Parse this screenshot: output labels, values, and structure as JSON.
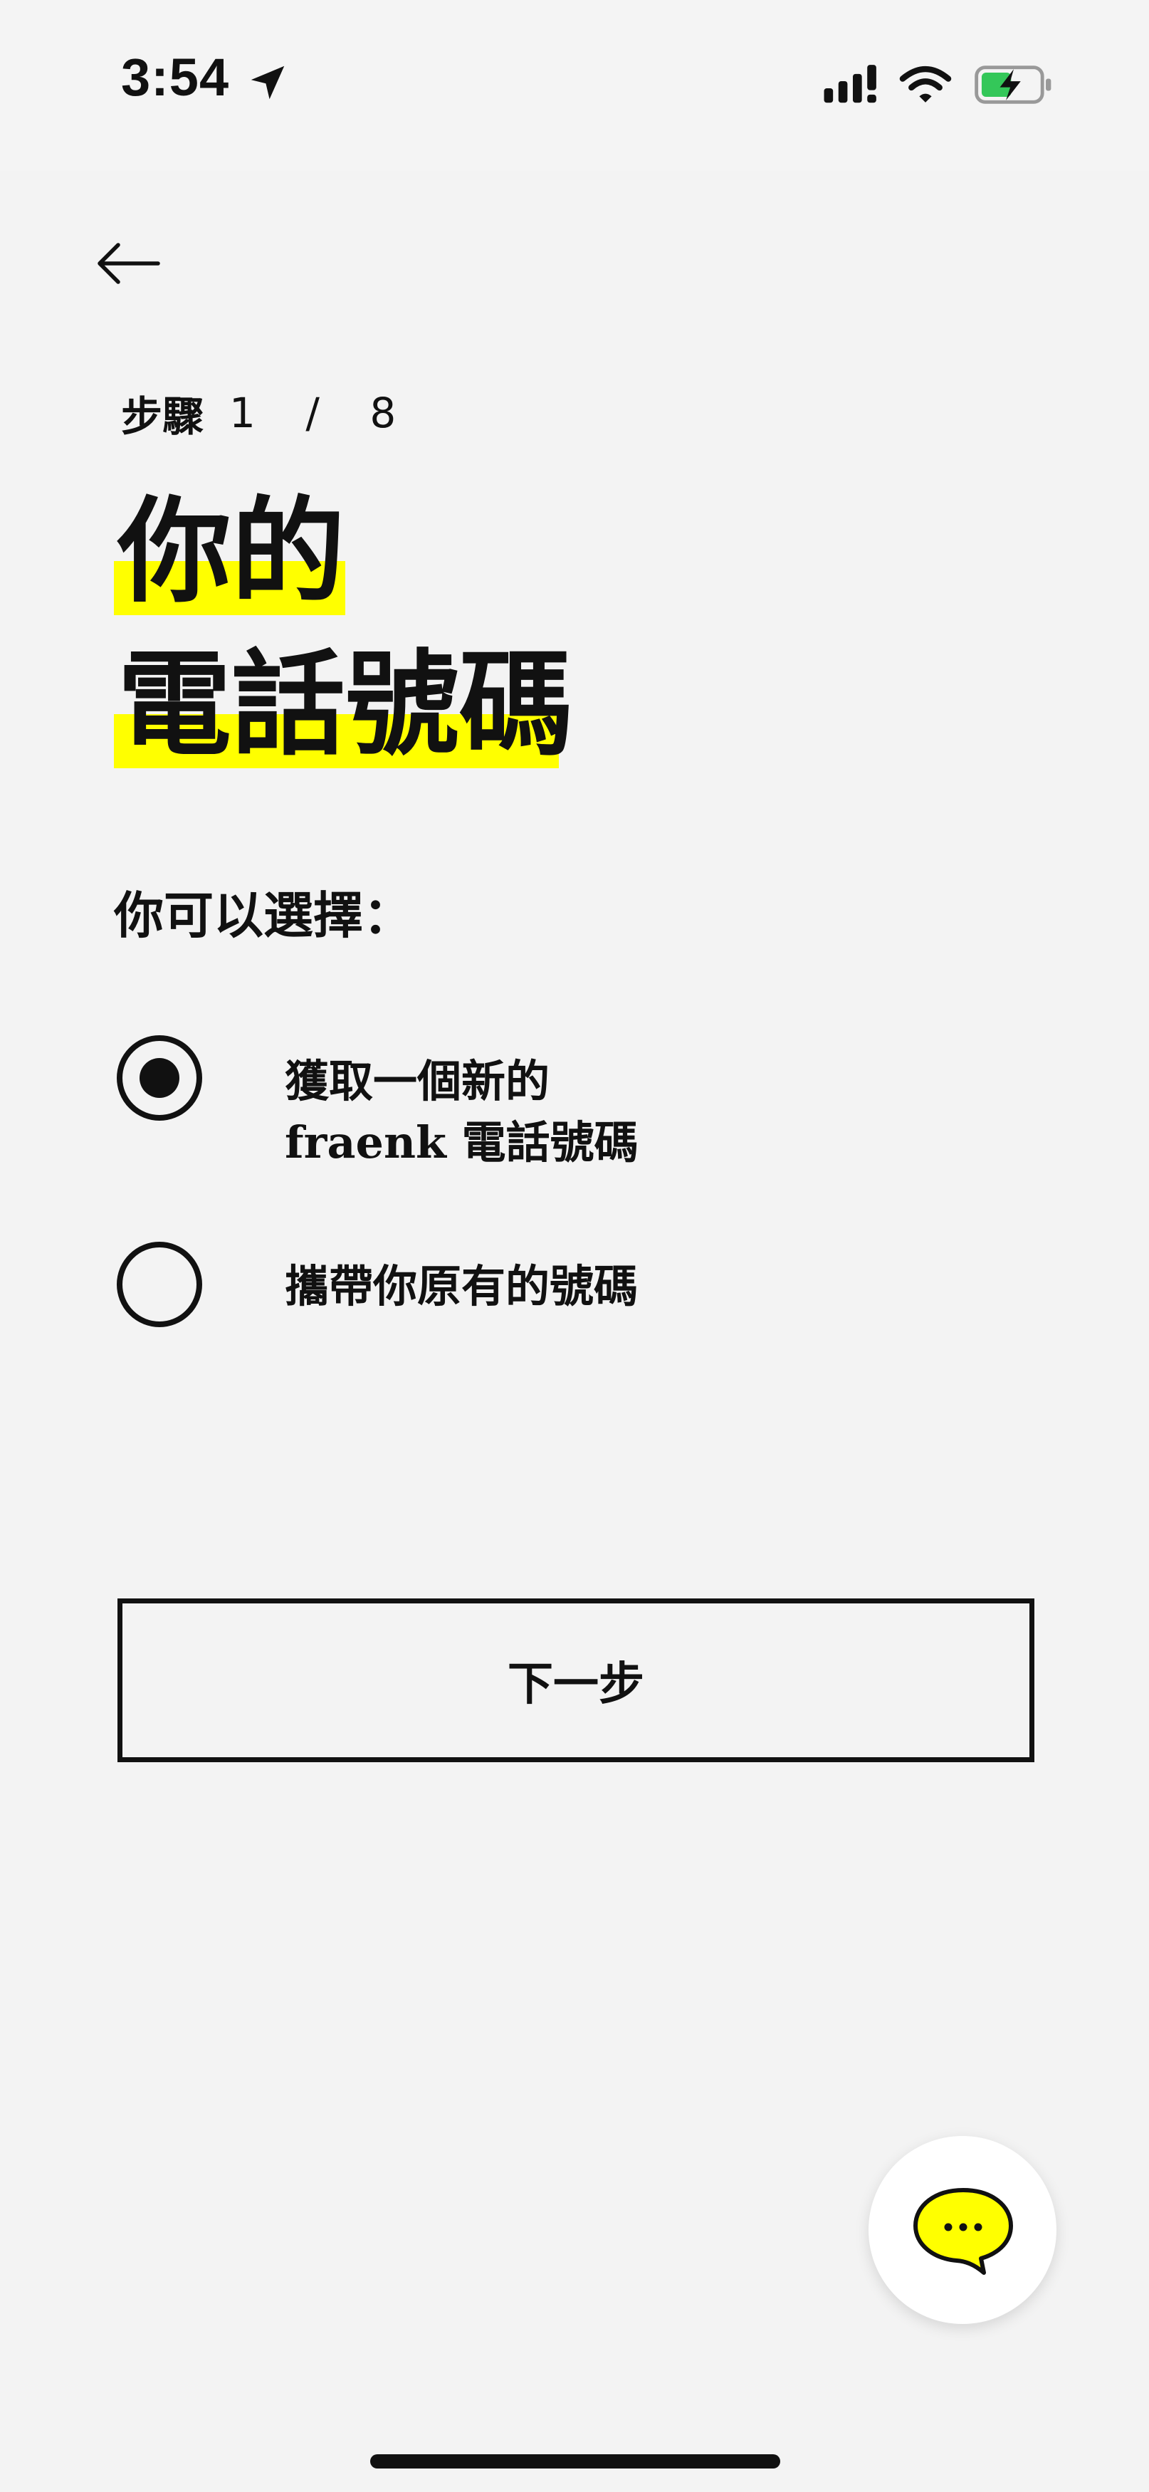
{
  "status_bar": {
    "time": "3:54",
    "icons": [
      "location-arrow-icon",
      "cellular-signal-icon",
      "wifi-icon",
      "battery-charging-icon"
    ],
    "battery_color": "#34c759"
  },
  "nav": {
    "back_icon": "arrow-left-icon"
  },
  "step": {
    "label": "步驟",
    "count": "1 / 8"
  },
  "title": {
    "line1": "你的",
    "line2": "電話號碼",
    "highlight_color": "#ffff00"
  },
  "subtitle": "你可以選擇：",
  "options": [
    {
      "line1": "獲取一個新的",
      "line2": "fraenk 電話號碼",
      "selected": true
    },
    {
      "line1": "攜帶你原有的號碼",
      "selected": false
    }
  ],
  "next_button": {
    "label": "下一步"
  },
  "chat": {
    "icon": "chat-bubble-icon",
    "accent_color": "#ffff00"
  }
}
